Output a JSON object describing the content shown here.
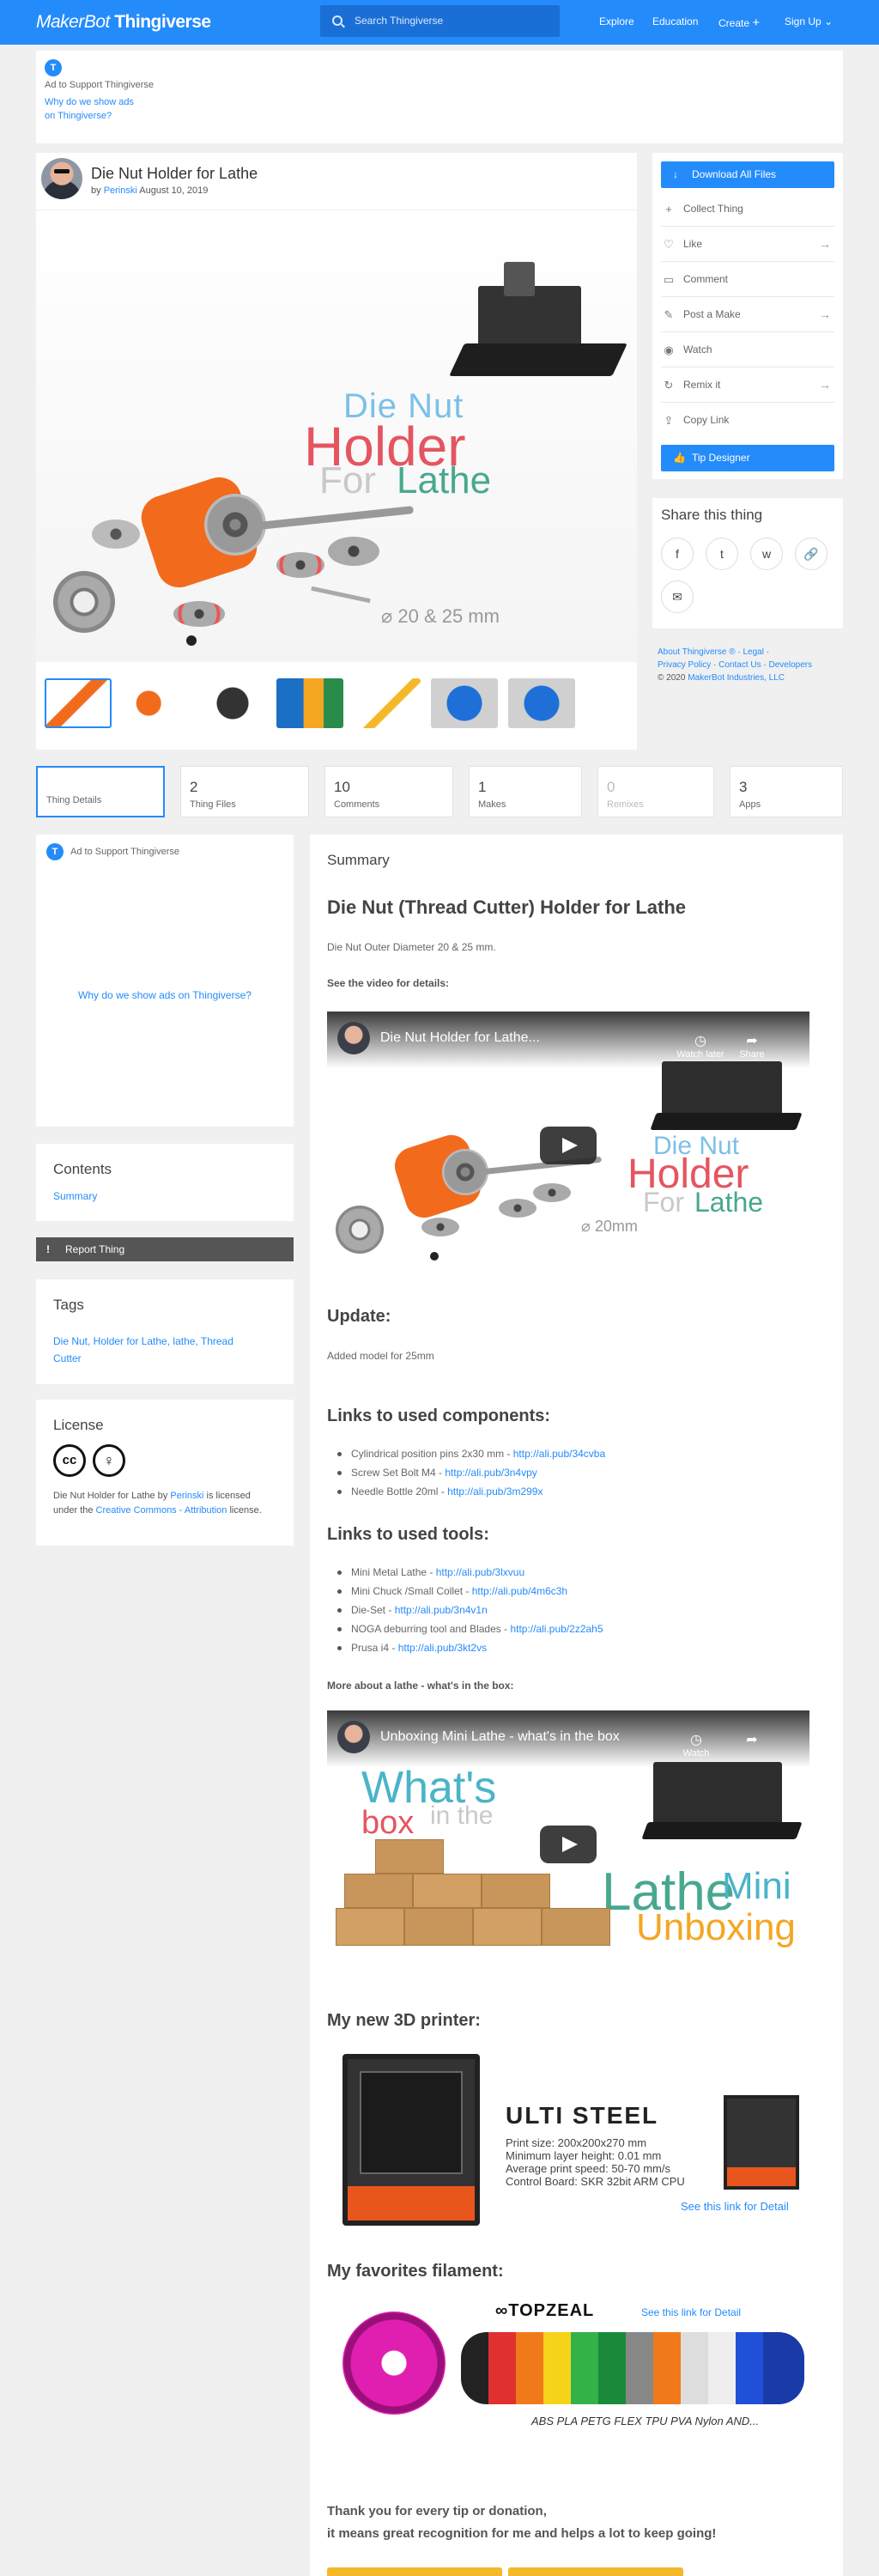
{
  "header": {
    "logo_brand": "MakerBot",
    "logo_product": "Thingiverse",
    "search_placeholder": "Search Thingiverse",
    "nav": [
      "Explore",
      "Education",
      "Create",
      "Sign Up"
    ]
  },
  "ad_top": {
    "badge": "T",
    "label": "Ad to Support Thingiverse",
    "why_line1": "Why do we show ads",
    "why_line2": "on Thingiverse?"
  },
  "thing": {
    "title": "Die Nut Holder for Lathe",
    "by": "by",
    "author": "Perinski",
    "date": "August 10, 2019",
    "hero_lines": [
      "Die Nut",
      "Holder",
      "For",
      "Lathe"
    ],
    "hero_dim": "⌀ 20 & 25 mm"
  },
  "actions": {
    "download": "Download All Files",
    "items": [
      "Collect Thing",
      "Like",
      "Comment",
      "Post a Make",
      "Watch",
      "Remix it",
      "Copy Link"
    ],
    "tip": "Tip Designer"
  },
  "share": {
    "title": "Share this thing",
    "icons": [
      "f",
      "t",
      "w",
      "🔗",
      "✉"
    ]
  },
  "footer": {
    "line1": [
      "About Thingiverse ®",
      "Legal"
    ],
    "line2": [
      "Privacy Policy",
      "Contact Us",
      "Developers"
    ],
    "copyright_year": "© 2020",
    "copyright_owner": "MakerBot Industries, LLC"
  },
  "tabs": [
    {
      "num": "",
      "label": "Thing Details"
    },
    {
      "num": "2",
      "label": "Thing Files"
    },
    {
      "num": "10",
      "label": "Comments"
    },
    {
      "num": "1",
      "label": "Makes"
    },
    {
      "num": "0",
      "label": "Remixes"
    },
    {
      "num": "3",
      "label": "Apps"
    }
  ],
  "sidebar": {
    "ad_label": "Ad to Support Thingiverse",
    "ad_why": "Why do we show ads on Thingiverse?",
    "contents_title": "Contents",
    "contents_link": "Summary",
    "report": "Report Thing",
    "tags_title": "Tags",
    "tags_line1": "Die Nut, Holder for Lathe, lathe, Thread",
    "tags_line2": "Cutter",
    "license_title": "License",
    "license_text1": "Die Nut Holder for Lathe by",
    "license_author": "Perinski",
    "license_text2": "is licensed under the",
    "license_link": "Creative Commons - Attribution",
    "license_text3": "license."
  },
  "summary": {
    "heading": "Summary",
    "title": "Die Nut (Thread Cutter) Holder for Lathe",
    "outer_diameter": "Die Nut Outer Diameter 20 & 25 mm.",
    "see_video": "See the video for details:",
    "video1_title": "Die Nut Holder for Lathe...",
    "video1_watch": "Watch later",
    "video1_share": "Share",
    "video1_dim": "⌀ 20mm",
    "update_h": "Update:",
    "update_text": "Added model for 25mm",
    "components_h": "Links to used components:",
    "components": [
      {
        "text": "Cylindrical position pins 2x30 mm - ",
        "link": "http://ali.pub/34cvba"
      },
      {
        "text": "Screw Set Bolt M4 - ",
        "link": "http://ali.pub/3n4vpy"
      },
      {
        "text": "Needle Bottle 20ml - ",
        "link": "http://ali.pub/3m299x"
      }
    ],
    "tools_h": "Links to used tools:",
    "tools": [
      {
        "text": "Mini Metal Lathe - ",
        "link": "http://ali.pub/3lxvuu"
      },
      {
        "text": "Mini Chuck /Small Collet - ",
        "link": "http://ali.pub/4m6c3h"
      },
      {
        "text": "Die-Set - ",
        "link": "http://ali.pub/3n4v1n"
      },
      {
        "text": "NOGA deburring tool and Blades - ",
        "link": "http://ali.pub/2z2ah5"
      },
      {
        "text": "Prusa i4 - ",
        "link": "http://ali.pub/3kt2vs"
      }
    ],
    "more_lathe": "More about a lathe - what's in the box:",
    "video2_title": "Unboxing Mini Lathe - what's in the box",
    "video2_watch": "Watch",
    "video2_text": [
      "What's",
      "box",
      "in the",
      "Lathe",
      "Mini",
      "Unboxing"
    ],
    "printer_h": "My new 3D printer:",
    "printer_name": "ULTI STEEL",
    "printer_specs": [
      "Print size: 200x200x270 mm",
      "Minimum layer height: 0.01 mm",
      "Average print speed: 50-70 mm/s",
      "Control Board: SKR 32bit ARM CPU"
    ],
    "printer_link": "See this link for Detail",
    "filament_h": "My favorites filament:",
    "filament_brand": "TOPZEAL",
    "filament_link": "See this link for Detail",
    "filament_types": "ABS PLA PETG FLEX TPU PVA Nylon AND...",
    "thanks1": "Thank you for every tip or donation,",
    "thanks2": "it means great recognition for me and helps a lot to keep going!"
  }
}
